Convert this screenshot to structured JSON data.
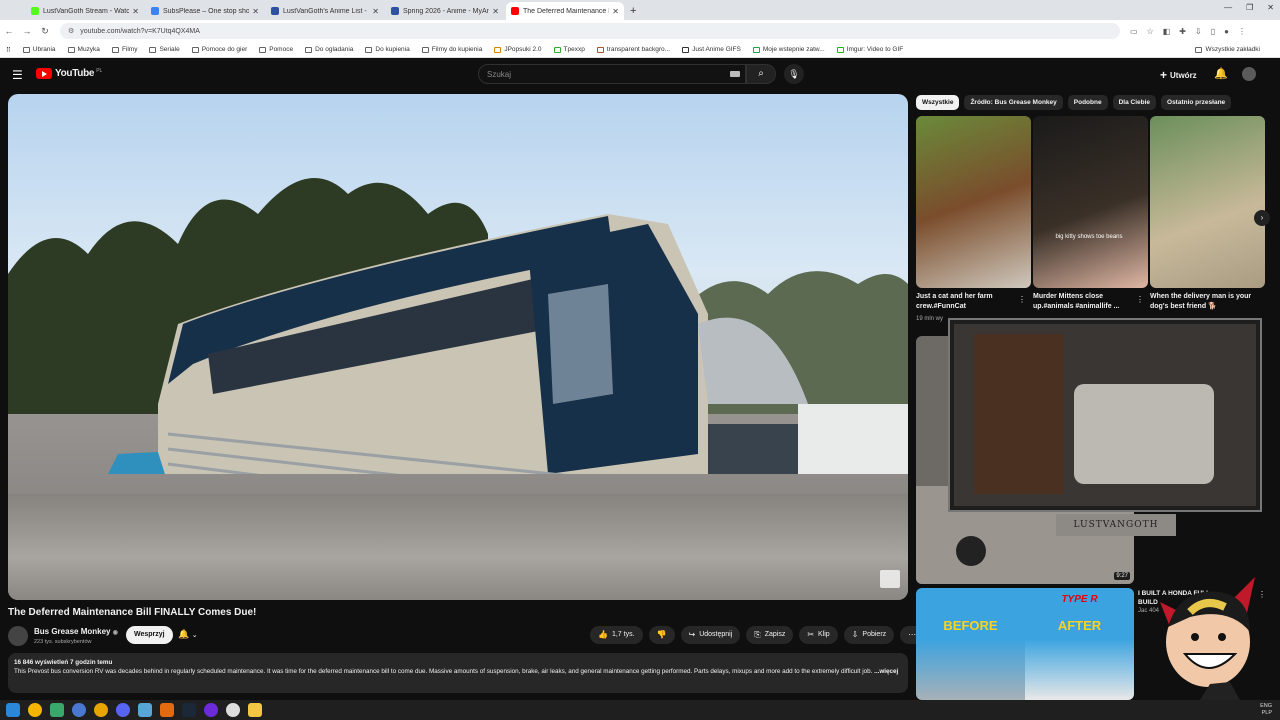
{
  "browser": {
    "tabs": [
      {
        "title": "LustVanGoth Stream - Watch L",
        "color": "#53fc18"
      },
      {
        "title": "SubsPlease – One stop shop fo",
        "color": "#3b82f6"
      },
      {
        "title": "LustVanGoth's Anime List - My",
        "color": "#2e51a2"
      },
      {
        "title": "Spring 2026 - Anime - MyAnim",
        "color": "#2e51a2"
      },
      {
        "title": "The Deferred Maintenance Bill",
        "color": "#ff0000"
      }
    ],
    "url": "youtube.com/watch?v=K7Utq4QX4MA",
    "bookmarks": [
      "Ubrania",
      "Muzyka",
      "Filmy",
      "Seriale",
      "Pomoce do gier",
      "Pomoce",
      "Do ogladania",
      "Do kupienia",
      "Filmy do kupienia",
      "JPopsuki 2.0",
      "Tpexxp",
      "transparent backgro...",
      "Just Anime GIFS",
      "Moje wstepnie zatw...",
      "Imgur: Video to GIF"
    ],
    "bookmarks_right": "Wszystkie zakładki"
  },
  "youtube": {
    "logo": "YouTube",
    "region": "PL",
    "search_placeholder": "Szukaj",
    "create_label": "Utwórz"
  },
  "video": {
    "title": "The Deferred Maintenance Bill FINALLY Comes Due!",
    "channel": "Bus Grease Monkey",
    "subscribers": "223 tys. subskrybentów",
    "support_label": "Wesprzyj",
    "likes": "1,7 tys.",
    "share_label": "Udostępnij",
    "save_label": "Zapisz",
    "clip_label": "Klip",
    "download_label": "Pobierz",
    "desc_meta": "16 846 wyświetleń  7 godzin temu",
    "desc_text": "This Prevost bus conversion RV was decades behind in regularly scheduled maintenance.  It was time for the deferred maintenance bill to come due.  Massive amounts of suspension, brake, air leaks, and general maintenance getting performed. Parts delays, mixups and more add to the extremely difficult job. ",
    "desc_more": "...więcej"
  },
  "sidebar": {
    "chips": [
      "Wszystkie",
      "Źródło: Bus Grease Monkey",
      "Podobne",
      "Dla Ciebie",
      "Ostatnio przesłane"
    ],
    "shorts": [
      {
        "title": "Just a cat and her farm crew.#FunnCat",
        "views": "19 mln wy"
      },
      {
        "title": "Murder Mittens close up.#animals #animallife ...",
        "caption": "big kitty shows toe beans"
      },
      {
        "title": "When the delivery man is your dog's best friend 🐕"
      }
    ],
    "rec1_duration": "9:27",
    "webcam_label": "LUSTVANGOTH",
    "rec2": {
      "before": "BEFORE",
      "after": "AFTER",
      "brand": "TYPE R",
      "title": "I BUILT A HONDA FULL BUILD",
      "meta": "Jac 404"
    }
  },
  "taskbar": {
    "lang": "ENG",
    "lang2": "PLP"
  }
}
